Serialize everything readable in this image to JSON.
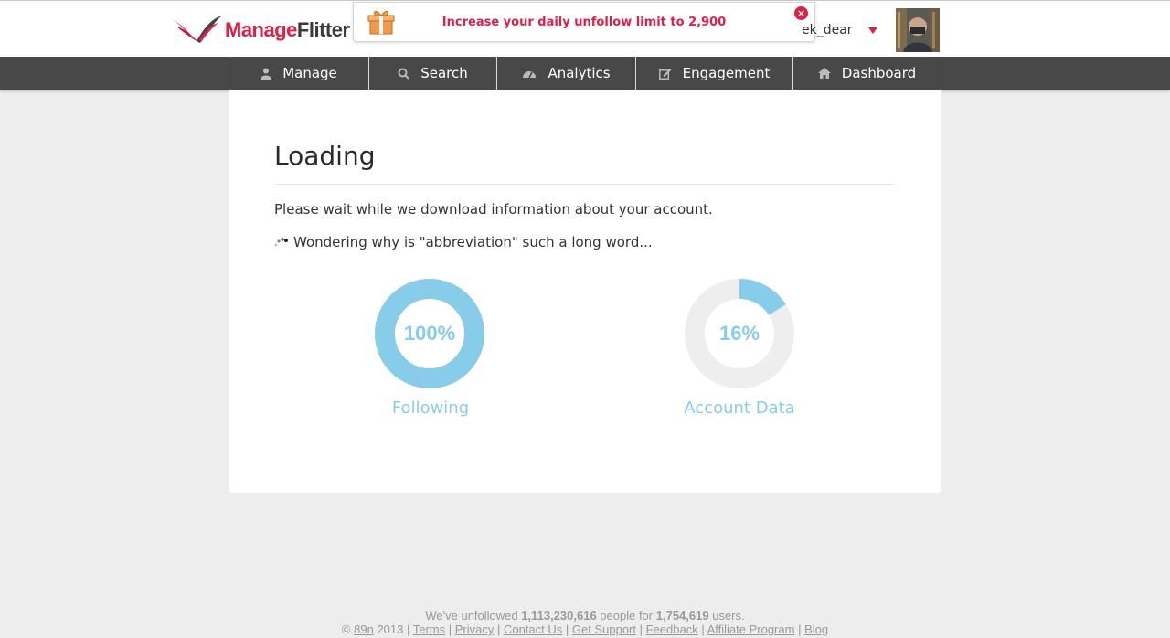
{
  "brand": {
    "logo_part1": "Manage",
    "logo_part2": "Flitter",
    "accent": "#e01f47"
  },
  "promo": {
    "text": "Increase your daily unfollow limit to 2,900",
    "close_symbol": "×"
  },
  "user": {
    "name": "ek_dear"
  },
  "nav": [
    {
      "label": "Manage",
      "icon": "user-icon"
    },
    {
      "label": "Search",
      "icon": "search-icon"
    },
    {
      "label": "Analytics",
      "icon": "dashboard-gauge-icon"
    },
    {
      "label": "Engagement",
      "icon": "edit-icon"
    },
    {
      "label": "Dashboard",
      "icon": "home-icon"
    }
  ],
  "main": {
    "title": "Loading",
    "message": "Please wait while we download information about your account.",
    "status": "Wondering why is \"abbreviation\" such a long word..."
  },
  "progress": [
    {
      "label": "Following",
      "percent_text": "100%",
      "value": 1.0
    },
    {
      "label": "Account Data",
      "percent_text": "16%",
      "value": 0.16
    }
  ],
  "progress_colors": {
    "fill": "#87cdea",
    "track": "#eeeeee"
  },
  "footer": {
    "stats_pre": "We've unfollowed",
    "unfollowed": "1,113,230,616",
    "stats_mid": "people for",
    "users": "1,754,619",
    "stats_post": "users.",
    "copyright": "©",
    "company": "89n",
    "year": "2013",
    "links": [
      "Terms",
      "Privacy",
      "Contact Us",
      "Get Support",
      "Feedback",
      "Affiliate Program",
      "Blog"
    ]
  }
}
